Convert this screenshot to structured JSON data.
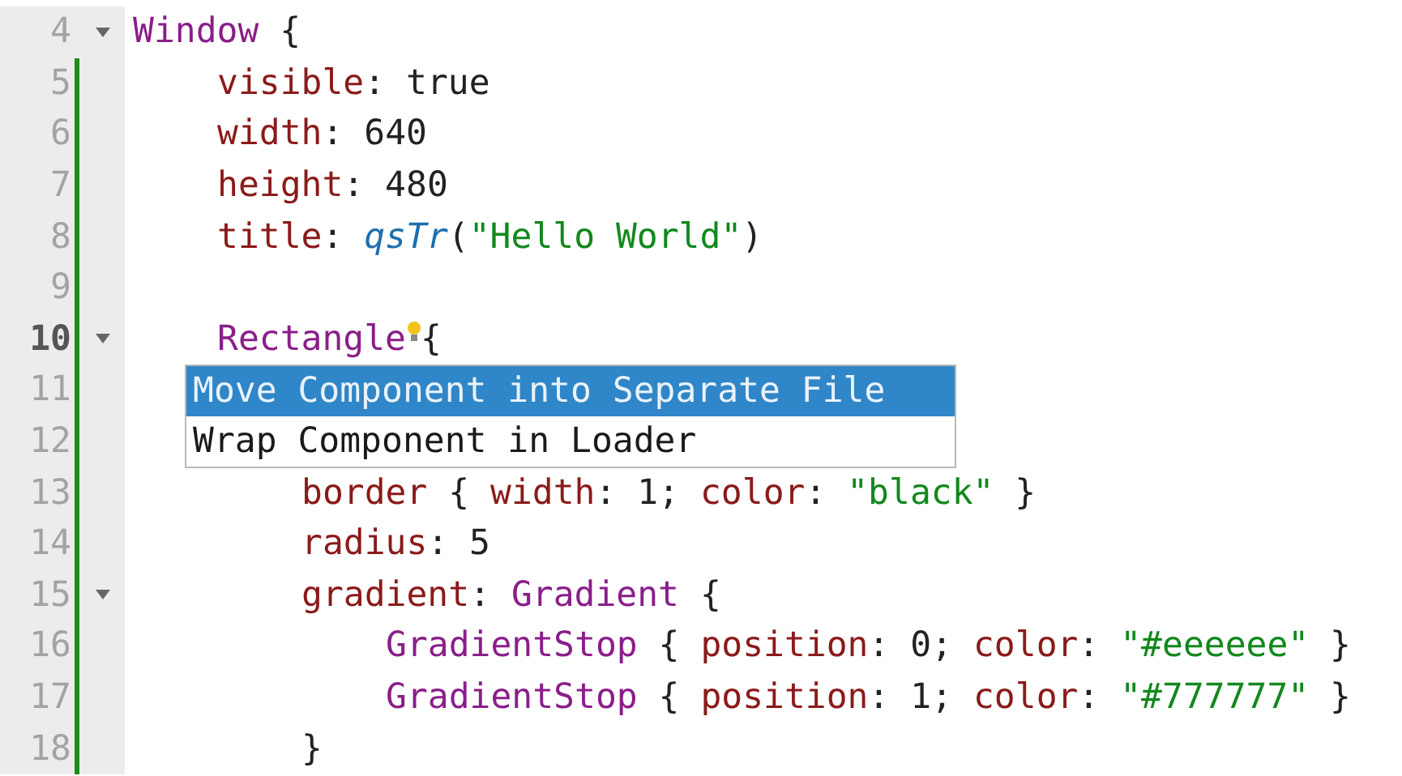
{
  "editor": {
    "lines": [
      {
        "number": "4",
        "current": false,
        "modified": false,
        "foldable": true,
        "tokens": [
          {
            "kind": "type",
            "text": "Window"
          },
          {
            "kind": "plain",
            "text": " {"
          }
        ],
        "children": [
          {
            "number": "5",
            "current": false,
            "modified": true,
            "foldable": false,
            "tokens": [
              {
                "kind": "property",
                "text": "visible"
              },
              {
                "kind": "plain",
                "text": ": true"
              }
            ]
          },
          {
            "number": "6",
            "current": false,
            "modified": true,
            "foldable": false,
            "tokens": [
              {
                "kind": "property",
                "text": "width"
              },
              {
                "kind": "plain",
                "text": ": 640"
              }
            ]
          },
          {
            "number": "7",
            "current": false,
            "modified": true,
            "foldable": false,
            "tokens": [
              {
                "kind": "property",
                "text": "height"
              },
              {
                "kind": "plain",
                "text": ": 480"
              }
            ]
          },
          {
            "number": "8",
            "current": false,
            "modified": true,
            "foldable": false,
            "tokens": [
              {
                "kind": "property",
                "text": "title"
              },
              {
                "kind": "plain",
                "text": ": "
              },
              {
                "kind": "function",
                "text": "qsTr"
              },
              {
                "kind": "plain",
                "text": "("
              },
              {
                "kind": "string",
                "text": "\"Hello World\""
              },
              {
                "kind": "plain",
                "text": ")"
              }
            ]
          },
          {
            "number": "9",
            "current": false,
            "modified": true,
            "foldable": false
          },
          {
            "number": "10",
            "current": true,
            "modified": true,
            "foldable": true,
            "tokens": [
              {
                "kind": "type",
                "text": "Rectangle"
              },
              {
                "kind": "hint"
              },
              {
                "kind": "plain",
                "text": "{"
              }
            ],
            "children": [
              {
                "number": "11",
                "current": false,
                "modified": true,
                "foldable": false
              },
              {
                "number": "12",
                "current": false,
                "modified": true,
                "foldable": false
              },
              {
                "number": "13",
                "current": false,
                "modified": true,
                "foldable": false,
                "tokens": [
                  {
                    "kind": "property",
                    "text": "border"
                  },
                  {
                    "kind": "plain",
                    "text": " { "
                  },
                  {
                    "kind": "property",
                    "text": "width"
                  },
                  {
                    "kind": "plain",
                    "text": ": 1; "
                  },
                  {
                    "kind": "property",
                    "text": "color"
                  },
                  {
                    "kind": "plain",
                    "text": ": "
                  },
                  {
                    "kind": "string",
                    "text": "\"black\""
                  },
                  {
                    "kind": "plain",
                    "text": " }"
                  }
                ]
              },
              {
                "number": "14",
                "current": false,
                "modified": true,
                "foldable": false,
                "tokens": [
                  {
                    "kind": "property",
                    "text": "radius"
                  },
                  {
                    "kind": "plain",
                    "text": ": 5"
                  }
                ]
              },
              {
                "number": "15",
                "current": false,
                "modified": true,
                "foldable": true,
                "tokens": [
                  {
                    "kind": "property",
                    "text": "gradient"
                  },
                  {
                    "kind": "plain",
                    "text": ": "
                  },
                  {
                    "kind": "type",
                    "text": "Gradient"
                  },
                  {
                    "kind": "plain",
                    "text": " {"
                  }
                ],
                "children": [
                  {
                    "number": "16",
                    "current": false,
                    "modified": true,
                    "foldable": false,
                    "tokens": [
                      {
                        "kind": "type",
                        "text": "GradientStop"
                      },
                      {
                        "kind": "plain",
                        "text": " { "
                      },
                      {
                        "kind": "property",
                        "text": "position"
                      },
                      {
                        "kind": "plain",
                        "text": ": 0; "
                      },
                      {
                        "kind": "property",
                        "text": "color"
                      },
                      {
                        "kind": "plain",
                        "text": ": "
                      },
                      {
                        "kind": "string",
                        "text": "\"#eeeeee\""
                      },
                      {
                        "kind": "plain",
                        "text": " }"
                      }
                    ]
                  },
                  {
                    "number": "17",
                    "current": false,
                    "modified": true,
                    "foldable": false,
                    "tokens": [
                      {
                        "kind": "type",
                        "text": "GradientStop"
                      },
                      {
                        "kind": "plain",
                        "text": " { "
                      },
                      {
                        "kind": "property",
                        "text": "position"
                      },
                      {
                        "kind": "plain",
                        "text": ": 1; "
                      },
                      {
                        "kind": "property",
                        "text": "color"
                      },
                      {
                        "kind": "plain",
                        "text": ": "
                      },
                      {
                        "kind": "string",
                        "text": "\"#777777\""
                      },
                      {
                        "kind": "plain",
                        "text": " }"
                      }
                    ]
                  }
                ]
              },
              {
                "number": "18",
                "current": false,
                "modified": true,
                "foldable": false,
                "tokens": [
                  {
                    "kind": "plain",
                    "text": "}"
                  }
                ]
              }
            ]
          }
        ]
      }
    ]
  },
  "quick_fix_menu": {
    "items": [
      {
        "label": "Move Component into Separate File",
        "selected": true
      },
      {
        "label": "Wrap Component in Loader",
        "selected": false
      }
    ]
  }
}
